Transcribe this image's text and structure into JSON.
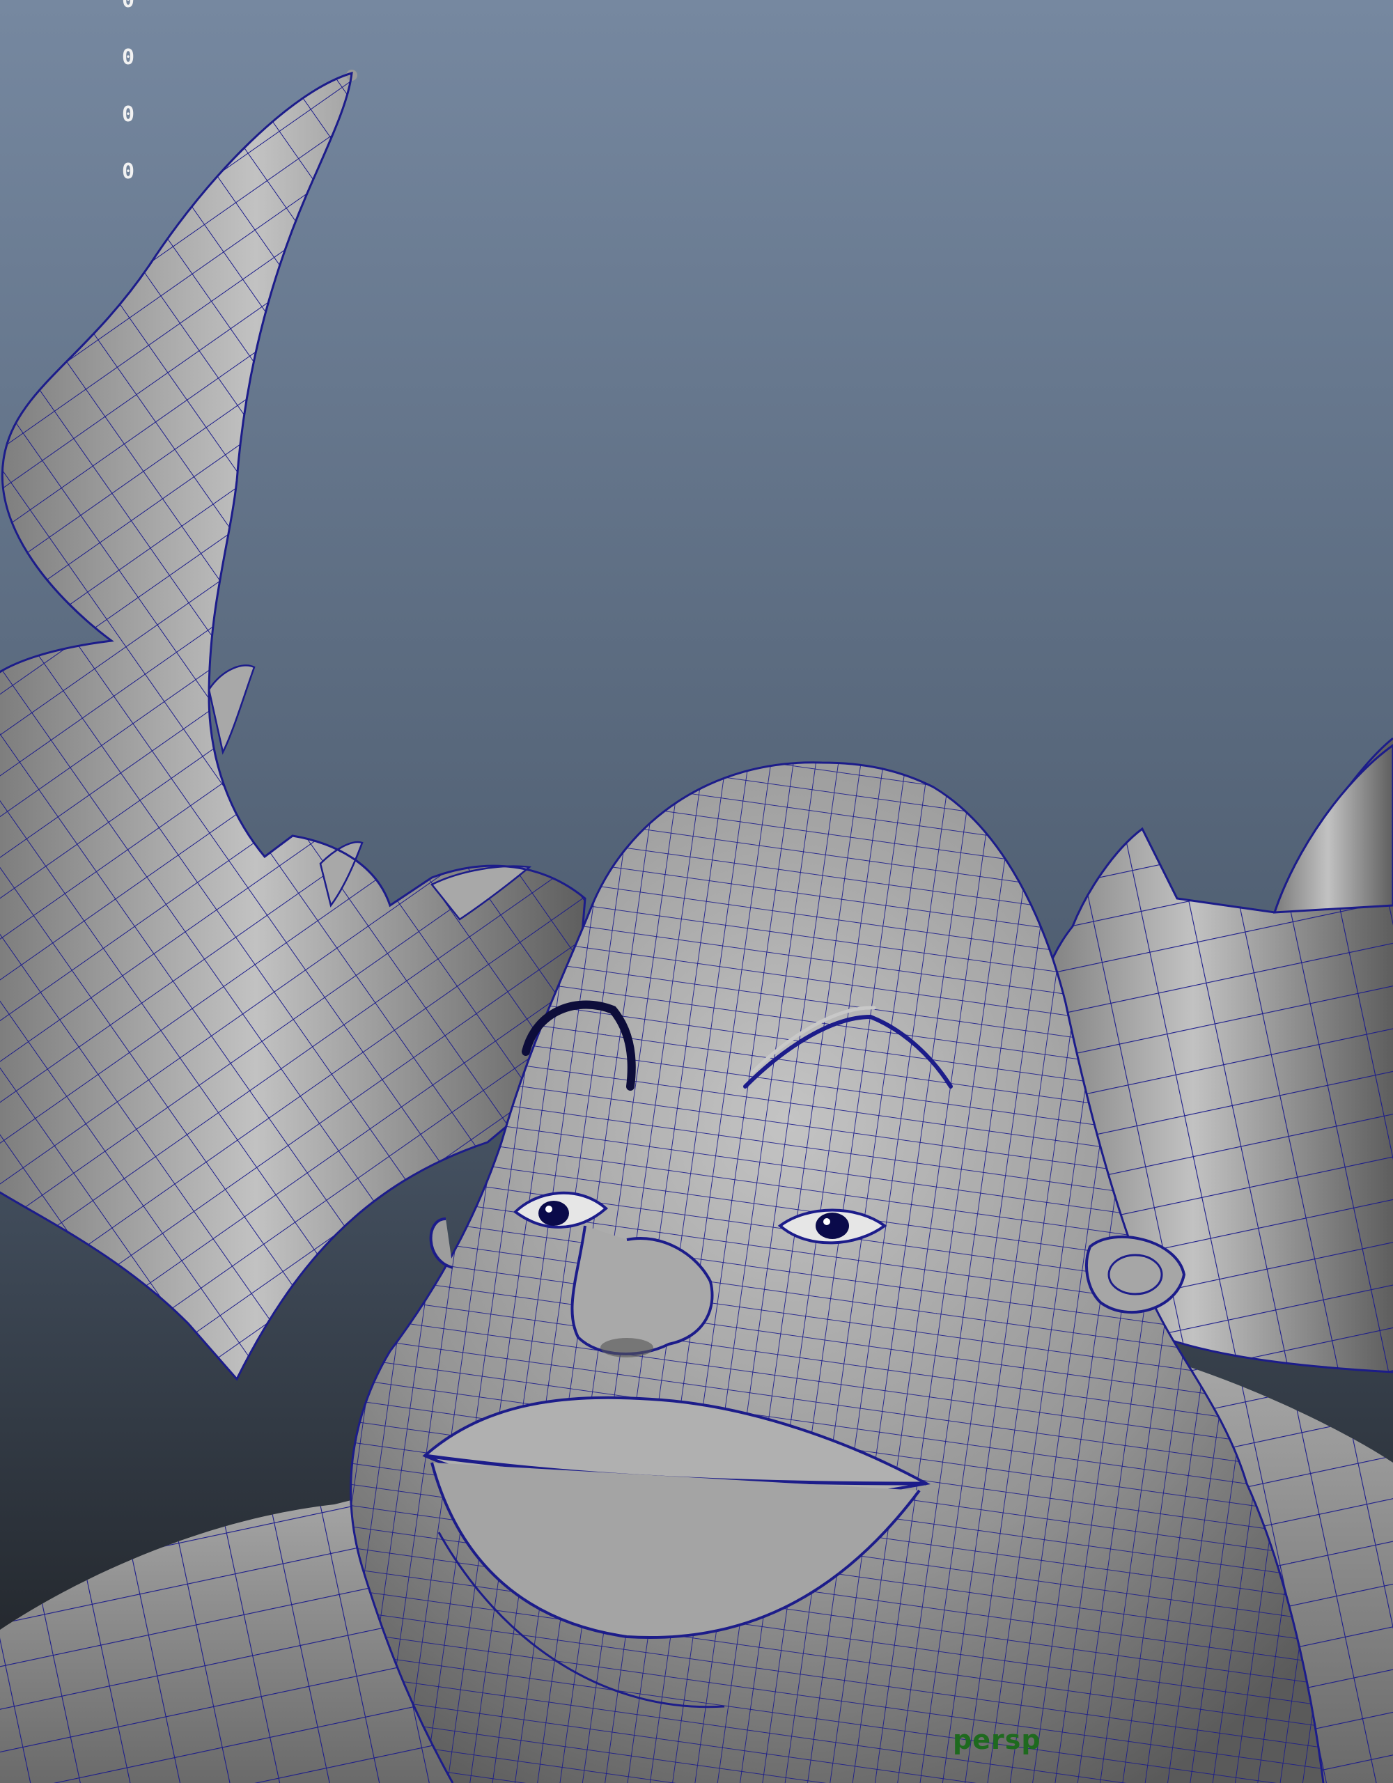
{
  "viewport": {
    "hud_stats": [
      "0",
      "0",
      "0",
      "0"
    ],
    "camera_label": "persp",
    "background_gradient": {
      "top": "#7688a0",
      "middle": "#4f5e71",
      "bottom": "#1b1d20"
    },
    "wireframe_color": "#1c1c8a",
    "shaded_surface_color": "#9a9a9a",
    "model": "horned-creature-head"
  }
}
